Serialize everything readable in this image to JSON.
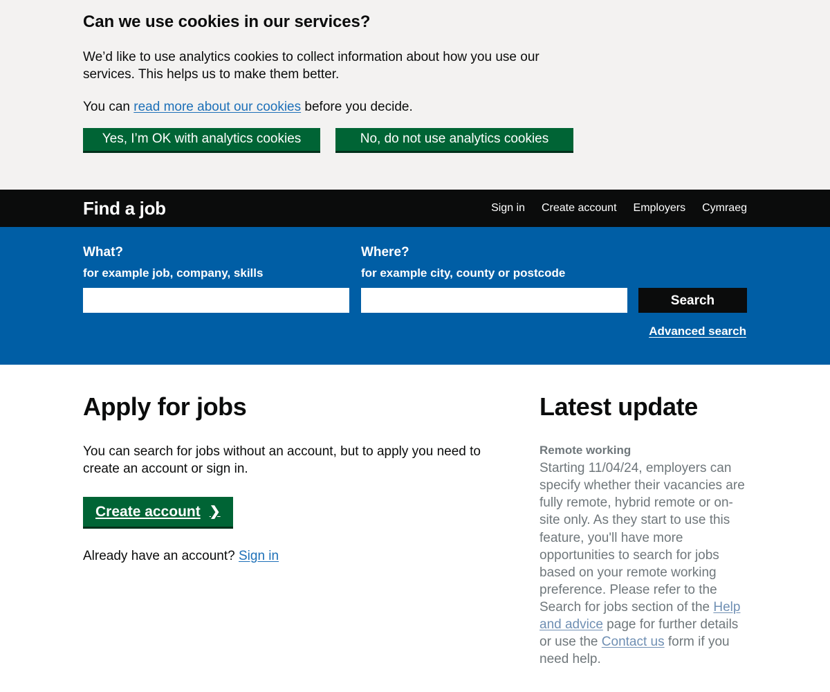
{
  "cookie_banner": {
    "title": "Can we use cookies in our services?",
    "paragraph": "We’d like to use analytics cookies to collect information about how you use our services. This helps us to make them better.",
    "decide_prefix": "You can ",
    "decide_link": "read more about our cookies",
    "decide_suffix": " before you decide.",
    "accept_label": "Yes, I’m OK with analytics cookies",
    "reject_label": "No, do not use analytics cookies",
    "colors": {
      "background": "#f3f2f1",
      "button": "#006435",
      "link": "#1d70b8"
    }
  },
  "header": {
    "brand": "Find a job",
    "nav": [
      {
        "label": "Sign in"
      },
      {
        "label": "Create account"
      },
      {
        "label": "Employers"
      },
      {
        "label": "Cymraeg"
      }
    ],
    "colors": {
      "background": "#0b0c0c",
      "text": "#ffffff"
    }
  },
  "search": {
    "what_label": "What?",
    "what_hint": "for example job, company, skills",
    "what_value": "",
    "what_placeholder": "",
    "where_label": "Where?",
    "where_hint": "for example city, county or postcode",
    "where_value": "",
    "where_placeholder": "",
    "search_button": "Search",
    "advanced_link": "Advanced search",
    "colors": {
      "band": "#005ea5",
      "button": "#0b0c0c"
    }
  },
  "main": {
    "left": {
      "heading": "Apply for jobs",
      "intro": "You can search for jobs without an account, but to apply you need to create an account or sign in.",
      "create_button": "Create account",
      "create_button_icon": "chevron-right-icon",
      "chevron": "❯",
      "already_prefix": "Already have an account? ",
      "already_link": "Sign in"
    },
    "right": {
      "heading": "Latest update",
      "subheading": "Remote working",
      "body_part1": "Starting 11/04/24, employers can specify whether their vacancies are fully remote, hybrid remote or on-site only. As they start to use this feature, you'll have more opportunities to search for jobs based on your remote working preference. Please refer to the Search for jobs section of the ",
      "link1": "Help and advice",
      "body_part2": " page for further details or use the ",
      "link2": "Contact us",
      "body_part3": " form if you need help.",
      "colors": {
        "text": "#6f777b",
        "link": "#6f8fb3"
      }
    }
  }
}
